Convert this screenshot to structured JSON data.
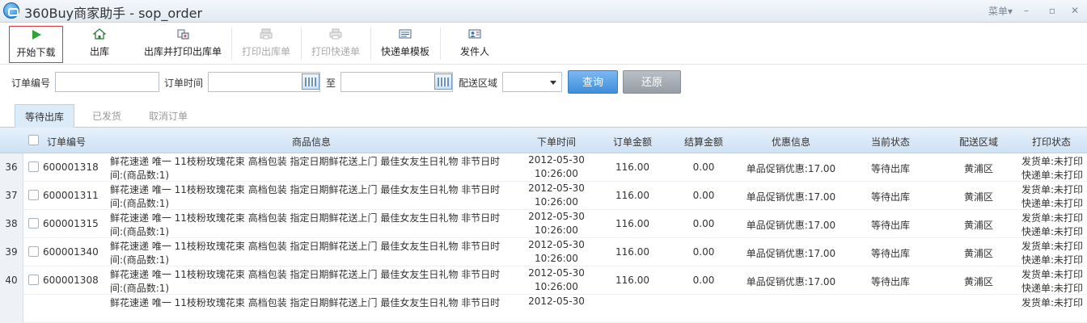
{
  "window": {
    "title": "360Buy商家助手 - sop_order",
    "menu_label": "菜单▾",
    "minimize": "–",
    "restore": "▫",
    "close": "✕"
  },
  "toolbar": {
    "items": [
      {
        "label": "开始下载",
        "icon": "play-icon",
        "state": "active"
      },
      {
        "label": "出库",
        "icon": "house-icon",
        "state": "normal"
      },
      {
        "label": "出库并打印出库单",
        "icon": "print-bag-icon",
        "state": "normal"
      },
      {
        "label": "打印出库单",
        "icon": "print-icon",
        "state": "disabled"
      },
      {
        "label": "打印快递单",
        "icon": "printer-icon",
        "state": "disabled"
      },
      {
        "label": "快递单模板",
        "icon": "template-icon",
        "state": "normal"
      },
      {
        "label": "发件人",
        "icon": "sender-card-icon",
        "state": "normal"
      }
    ]
  },
  "filters": {
    "order_no_label": "订单编号",
    "order_time_label": "订单时间",
    "to_label": "至",
    "region_label": "配送区域",
    "query_button": "查询",
    "reset_button": "还原"
  },
  "tabs": [
    "等待出库",
    "已发货",
    "取消订单"
  ],
  "grid": {
    "columns": [
      "订单编号",
      "商品信息",
      "下单时间",
      "订单金额",
      "结算金额",
      "优惠信息",
      "当前状态",
      "配送区域",
      "打印状态"
    ],
    "rows": [
      {
        "num": "36",
        "order_no": "600001318",
        "product_line1": "鲜花速递 唯一 11枝粉玫瑰花束 高档包装 指定日期鲜花送上门 最佳女友生日礼物  非节日时",
        "product_line2": "间:(商品数:1)",
        "date": "2012-05-30",
        "time": "10:26:00",
        "amount": "116.00",
        "settle": "0.00",
        "promo": "单品促销优惠:17.00",
        "status": "等待出库",
        "region": "黄浦区",
        "print1": "发货单:未打印",
        "print2": "快递单:未打印"
      },
      {
        "num": "37",
        "order_no": "600001311",
        "product_line1": "鲜花速递 唯一 11枝粉玫瑰花束 高档包装 指定日期鲜花送上门 最佳女友生日礼物  非节日时",
        "product_line2": "间:(商品数:1)",
        "date": "2012-05-30",
        "time": "10:26:00",
        "amount": "116.00",
        "settle": "0.00",
        "promo": "单品促销优惠:17.00",
        "status": "等待出库",
        "region": "黄浦区",
        "print1": "发货单:未打印",
        "print2": "快递单:未打印"
      },
      {
        "num": "38",
        "order_no": "600001315",
        "product_line1": "鲜花速递 唯一 11枝粉玫瑰花束 高档包装 指定日期鲜花送上门 最佳女友生日礼物  非节日时",
        "product_line2": "间:(商品数:1)",
        "date": "2012-05-30",
        "time": "10:26:00",
        "amount": "116.00",
        "settle": "0.00",
        "promo": "单品促销优惠:17.00",
        "status": "等待出库",
        "region": "黄浦区",
        "print1": "发货单:未打印",
        "print2": "快递单:未打印"
      },
      {
        "num": "39",
        "order_no": "600001340",
        "product_line1": "鲜花速递 唯一 11枝粉玫瑰花束 高档包装 指定日期鲜花送上门 最佳女友生日礼物  非节日时",
        "product_line2": "间:(商品数:1)",
        "date": "2012-05-30",
        "time": "10:26:00",
        "amount": "116.00",
        "settle": "0.00",
        "promo": "单品促销优惠:17.00",
        "status": "等待出库",
        "region": "黄浦区",
        "print1": "发货单:未打印",
        "print2": "快递单:未打印"
      },
      {
        "num": "40",
        "order_no": "600001308",
        "product_line1": "鲜花速递 唯一 11枝粉玫瑰花束 高档包装 指定日期鲜花送上门 最佳女友生日礼物  非节日时",
        "product_line2": "间:(商品数:1)",
        "date": "2012-05-30",
        "time": "10:26:00",
        "amount": "116.00",
        "settle": "0.00",
        "promo": "单品促销优惠:17.00",
        "status": "等待出库",
        "region": "黄浦区",
        "print1": "发货单:未打印",
        "print2": "快递单:未打印"
      },
      {
        "num": "",
        "order_no": "",
        "product_line1": "鲜花速递 唯一 11枝粉玫瑰花束 高档包装 指定日期鲜花送上门 最佳女友生日礼物  非节日时",
        "product_line2": "",
        "date": "2012-05-30",
        "time": "",
        "amount": "",
        "settle": "",
        "promo": "",
        "status": "",
        "region": "",
        "print1": "发货单:未打印",
        "print2": ""
      }
    ]
  },
  "colors": {
    "accent": "#3f8edc",
    "header_bg": "#cde1f4",
    "active_border": "#d9363e"
  }
}
